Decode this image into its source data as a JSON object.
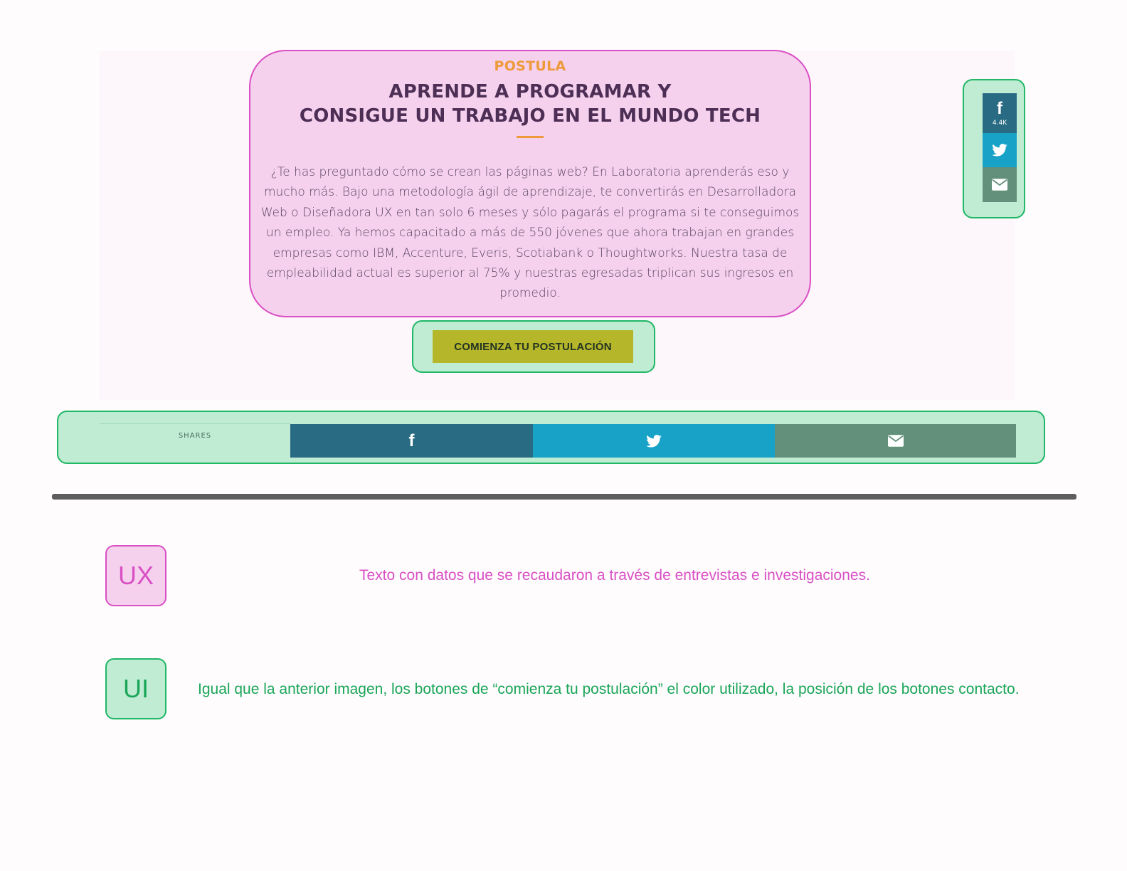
{
  "hero": {
    "eyebrow": "POSTULA",
    "headline_line1": "APRENDE A PROGRAMAR Y",
    "headline_line2": "CONSIGUE UN TRABAJO EN EL MUNDO TECH",
    "body": "¿Te has preguntado cómo se crean las páginas web? En Laboratoria aprenderás eso y mucho más. Bajo una metodología ágil de aprendizaje, te convertirás en Desarrolladora Web o Diseñadora UX en tan solo 6 meses y sólo pagarás el programa si te conseguimos un empleo. Ya hemos capacitado a más de 550 jóvenes que ahora trabajan en grandes empresas como IBM, Accenture, Everis, Scotiabank o Thoughtworks. Nuestra tasa de empleabilidad actual es superior al 75% y nuestras egresadas triplican sus ingresos en promedio.",
    "cta_label": "COMIENZA TU POSTULACIÓN"
  },
  "share_side": {
    "facebook_count": "4.4K",
    "icons": [
      "facebook-icon",
      "twitter-icon",
      "email-icon"
    ]
  },
  "share_bar": {
    "label": "SHARES",
    "icons": [
      "facebook-icon",
      "twitter-icon",
      "email-icon"
    ]
  },
  "annotations": [
    {
      "tag": "UX",
      "text": "Texto con datos que se recaudaron a través de entrevistas e investigaciones.",
      "color": "#d94fc4"
    },
    {
      "tag": "UI",
      "text": "Igual que la anterior imagen, los botones de “comienza tu postulación”  el color utilizado, la posición de los botones contacto.",
      "color": "#1aa558"
    }
  ],
  "colors": {
    "facebook": "#2a6b84",
    "twitter": "#18a2c8",
    "email": "#62907a",
    "cta": "#b6b62a",
    "accent": "#ee9a3a"
  }
}
